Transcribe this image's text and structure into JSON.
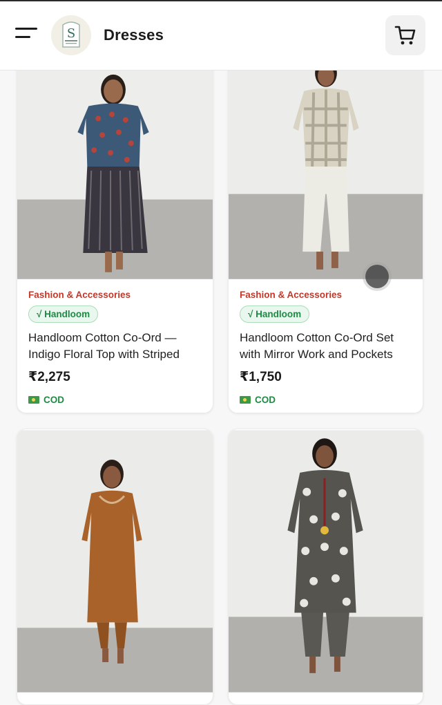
{
  "header": {
    "title": "Dresses",
    "menu_icon": "hamburger-menu-icon",
    "logo_icon": "store-logo-icon",
    "cart_icon": "shopping-cart-icon"
  },
  "products": [
    {
      "category": "Fashion & Accessories",
      "badge": "√ Handloom",
      "name": "Handloom Cotton Co-Ord — Indigo Floral Top with Striped",
      "price": "₹2,275",
      "payment": "COD"
    },
    {
      "category": "Fashion & Accessories",
      "badge": "√ Handloom",
      "name": "Handloom Cotton Co-Ord Set with Mirror Work and Pockets",
      "price": "₹1,750",
      "payment": "COD"
    },
    {
      "category": "",
      "badge": "",
      "name": "",
      "price": "",
      "payment": ""
    },
    {
      "category": "",
      "badge": "",
      "name": "",
      "price": "",
      "payment": ""
    }
  ],
  "colors": {
    "category": "#c0392b",
    "badge_green": "#1e8a43",
    "brand_cream": "#f1efe6"
  }
}
